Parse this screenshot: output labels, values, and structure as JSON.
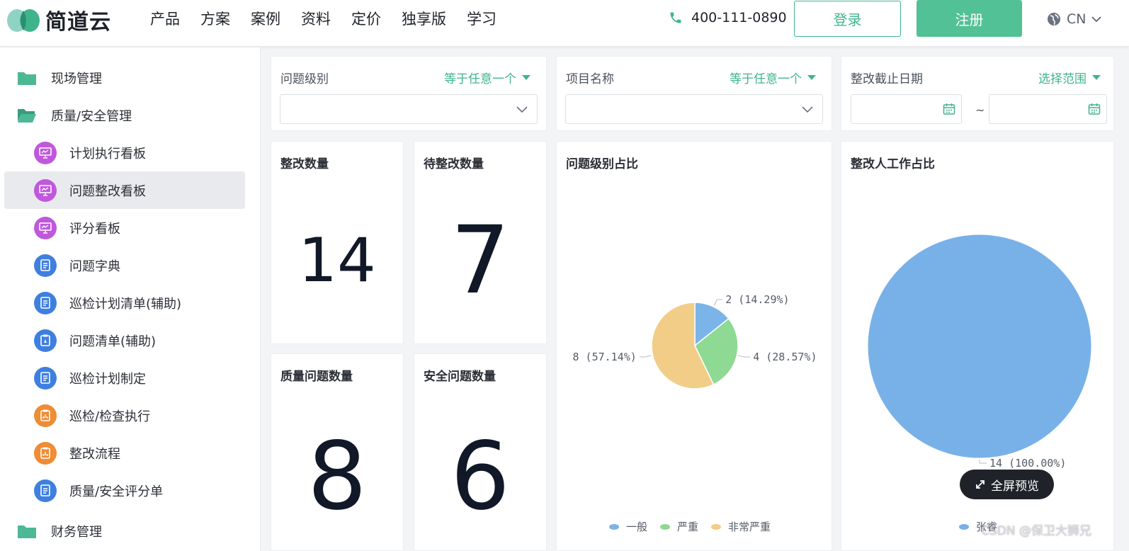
{
  "brand": {
    "name": "简道云"
  },
  "nav": {
    "items": [
      "产品",
      "方案",
      "案例",
      "资料",
      "定价",
      "独享版",
      "学习"
    ]
  },
  "header": {
    "phone": "400-111-0890",
    "login": "登录",
    "register": "注册",
    "lang": "CN"
  },
  "sidebar": {
    "items": [
      {
        "label": "现场管理",
        "kind": "group",
        "icon": "folder-icon"
      },
      {
        "label": "质量/安全管理",
        "kind": "group",
        "icon": "folder-open-icon"
      },
      {
        "label": "计划执行看板",
        "kind": "child",
        "icon": "dashboard-icon",
        "color": "#c058dd"
      },
      {
        "label": "问题整改看板",
        "kind": "child",
        "icon": "dashboard-icon",
        "color": "#c058dd",
        "active": true
      },
      {
        "label": "评分看板",
        "kind": "child",
        "icon": "dashboard-icon",
        "color": "#c058dd"
      },
      {
        "label": "问题字典",
        "kind": "child",
        "icon": "form-icon",
        "color": "#3e7fe0"
      },
      {
        "label": "巡检计划清单(辅助)",
        "kind": "child",
        "icon": "form-icon",
        "color": "#3e7fe0"
      },
      {
        "label": "问题清单(辅助)",
        "kind": "child",
        "icon": "clipboard-icon",
        "color": "#3e7fe0"
      },
      {
        "label": "巡检计划制定",
        "kind": "child",
        "icon": "form-icon",
        "color": "#3e7fe0"
      },
      {
        "label": "巡检/检查执行",
        "kind": "child",
        "icon": "flow-icon",
        "color": "#ef8c34"
      },
      {
        "label": "整改流程",
        "kind": "child",
        "icon": "flow-icon",
        "color": "#ef8c34"
      },
      {
        "label": "质量/安全评分单",
        "kind": "child",
        "icon": "form-icon",
        "color": "#3e7fe0"
      },
      {
        "label": "财务管理",
        "kind": "group",
        "icon": "folder-icon"
      }
    ]
  },
  "filters": [
    {
      "label": "问题级别",
      "mode": "等于任意一个",
      "type": "select"
    },
    {
      "label": "项目名称",
      "mode": "等于任意一个",
      "type": "select"
    },
    {
      "label": "整改截止日期",
      "mode": "选择范围",
      "type": "daterange",
      "separator": "~"
    }
  ],
  "kpis": [
    {
      "title": "整改数量",
      "value": "14"
    },
    {
      "title": "待整改数量",
      "value": "7"
    },
    {
      "title": "质量问题数量",
      "value": "8"
    },
    {
      "title": "安全问题数量",
      "value": "6"
    }
  ],
  "chart_data": [
    {
      "type": "pie",
      "title": "问题级别占比",
      "categories": [
        "一般",
        "严重",
        "非常严重"
      ],
      "values": [
        2,
        4,
        8
      ],
      "labels": [
        "2 (14.29%)",
        "4 (28.57%)",
        "8 (57.14%)"
      ],
      "colors": [
        "#7ab4e8",
        "#8ed993",
        "#f2cd88"
      ],
      "legend": "bottom"
    },
    {
      "type": "pie",
      "title": "整改人工作占比",
      "categories": [
        "张睿"
      ],
      "values": [
        14
      ],
      "labels": [
        "14 (100.00%)"
      ],
      "colors": [
        "#78b1e8"
      ],
      "legend": "bottom"
    }
  ],
  "overlay": {
    "fullscreen": "全屏预览",
    "watermark": "CSDN @保卫大狮兄"
  }
}
